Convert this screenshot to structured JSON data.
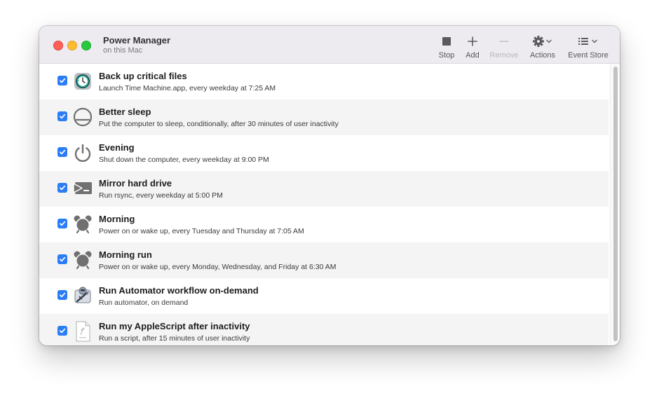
{
  "window": {
    "title": "Power Manager",
    "subtitle": "on this Mac"
  },
  "toolbar": {
    "stop": {
      "label": "Stop",
      "icon": "stop-icon",
      "enabled": true
    },
    "add": {
      "label": "Add",
      "icon": "plus-icon",
      "enabled": true
    },
    "remove": {
      "label": "Remove",
      "icon": "minus-icon",
      "enabled": false
    },
    "actions": {
      "label": "Actions",
      "icon": "gear-icon",
      "enabled": true
    },
    "event_store": {
      "label": "Event Store",
      "icon": "list-icon",
      "enabled": true
    }
  },
  "events": [
    {
      "title": "Back up critical files",
      "subtitle": "Launch Time Machine.app, every weekday at 7:25 AM",
      "icon": "time-machine-icon",
      "checked": true
    },
    {
      "title": "Better sleep",
      "subtitle": "Put the computer to sleep, conditionally, after 30 minutes of user inactivity",
      "icon": "sleep-icon",
      "checked": true
    },
    {
      "title": "Evening",
      "subtitle": "Shut down the computer, every weekday at 9:00 PM",
      "icon": "power-icon",
      "checked": true
    },
    {
      "title": "Mirror hard drive",
      "subtitle": "Run rsync, every weekday at 5:00 PM",
      "icon": "terminal-icon",
      "checked": true
    },
    {
      "title": "Morning",
      "subtitle": "Power on or wake up, every Tuesday and Thursday at 7:05 AM",
      "icon": "alarm-clock-icon",
      "checked": true
    },
    {
      "title": "Morning run",
      "subtitle": "Power on or wake up, every Monday, Wednesday, and Friday at 6:30 AM",
      "icon": "alarm-clock-icon",
      "checked": true
    },
    {
      "title": "Run Automator workflow on-demand",
      "subtitle": "Run automator, on demand",
      "icon": "automator-icon",
      "checked": true
    },
    {
      "title": "Run my AppleScript after inactivity",
      "subtitle": "Run a script, after 15 minutes of user inactivity",
      "icon": "applescript-file-icon",
      "checked": true
    }
  ],
  "colors": {
    "accent": "#2a7df4",
    "titlebar": "#eeebf0",
    "row_alt": "#f4f4f5"
  }
}
